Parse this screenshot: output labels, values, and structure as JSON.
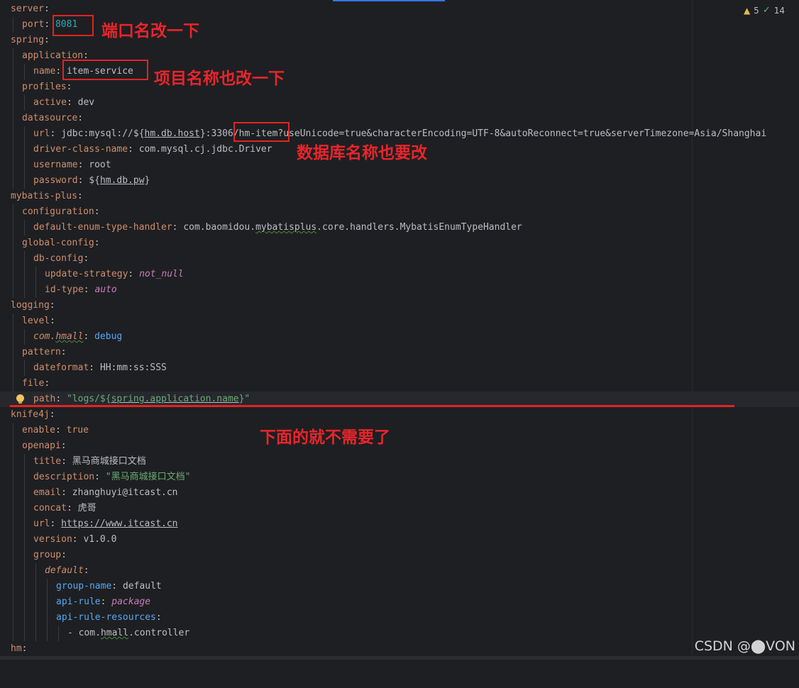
{
  "inspections": {
    "warnings": "5",
    "checks": "14"
  },
  "annotations": {
    "port_note": "端口名改一下",
    "name_note": "项目名称也改一下",
    "db_note": "数据库名称也要改",
    "below_note": "下面的就不需要了"
  },
  "watermark": "CSDN @⬤VON",
  "code": {
    "server": "server",
    "port_key": "port",
    "port_val": "8081",
    "spring": "spring",
    "application": "application",
    "name_key": "name",
    "name_val": "item-service",
    "profiles": "profiles",
    "active_key": "active",
    "active_val": "dev",
    "datasource": "datasource",
    "url_key": "url",
    "url_val_a": "jdbc:mysql://${",
    "url_val_host": "hm.db.host",
    "url_val_b": "}:3306/hm-item?useUnicode=true&characterEncoding=UTF-8&autoReconnect=true&serverTimezone=Asia/Shanghai",
    "driver_key": "driver-class-name",
    "driver_val": "com.mysql.cj.jdbc.Driver",
    "username_key": "username",
    "username_val": "root",
    "password_key": "password",
    "password_a": "${",
    "password_ref": "hm.db.pw",
    "password_b": "}",
    "mybatis": "mybatis-plus",
    "configuration": "configuration",
    "enum_key": "default-enum-type-handler",
    "enum_a": "com.baomidou.",
    "enum_w": "mybatisplus",
    "enum_b": ".core.handlers.MybatisEnumTypeHandler",
    "global_config": "global-config",
    "db_config": "db-config",
    "update_key": "update-strategy",
    "update_val": "not_null",
    "idtype_key": "id-type",
    "idtype_val": "auto",
    "logging": "logging",
    "level": "level",
    "com_a": "com.",
    "com_w": "hmall",
    "com_val": "debug",
    "pattern": "pattern",
    "dateformat_key": "dateformat",
    "dateformat_val": "HH:mm:ss:SSS",
    "file": "file",
    "path_key": "path",
    "path_a": "\"logs/${",
    "path_ref": "spring.application.name",
    "path_b": "}\"",
    "knife": "knife4j",
    "enable_key": "enable",
    "enable_val": "true",
    "openapi": "openapi",
    "title_key": "title",
    "title_val": "黑马商城接口文档",
    "desc_key": "description",
    "desc_val": "\"黑马商城接口文档\"",
    "email_key": "email",
    "email_val": "zhanghuyi@itcast.cn",
    "concat_key": "concat",
    "concat_val": "虎哥",
    "url2_key": "url",
    "url2_val": "https://www.itcast.cn",
    "version_key": "version",
    "version_val": "v1.0.0",
    "group": "group",
    "default_key": "default",
    "groupname_key": "group-name",
    "groupname_val": "default",
    "apirule_key": "api-rule",
    "apirule_val": "package",
    "apires_key": "api-rule-resources",
    "res_dash": "- com.",
    "res_w": "hmall",
    "res_b": ".controller",
    "hm": "hm"
  }
}
